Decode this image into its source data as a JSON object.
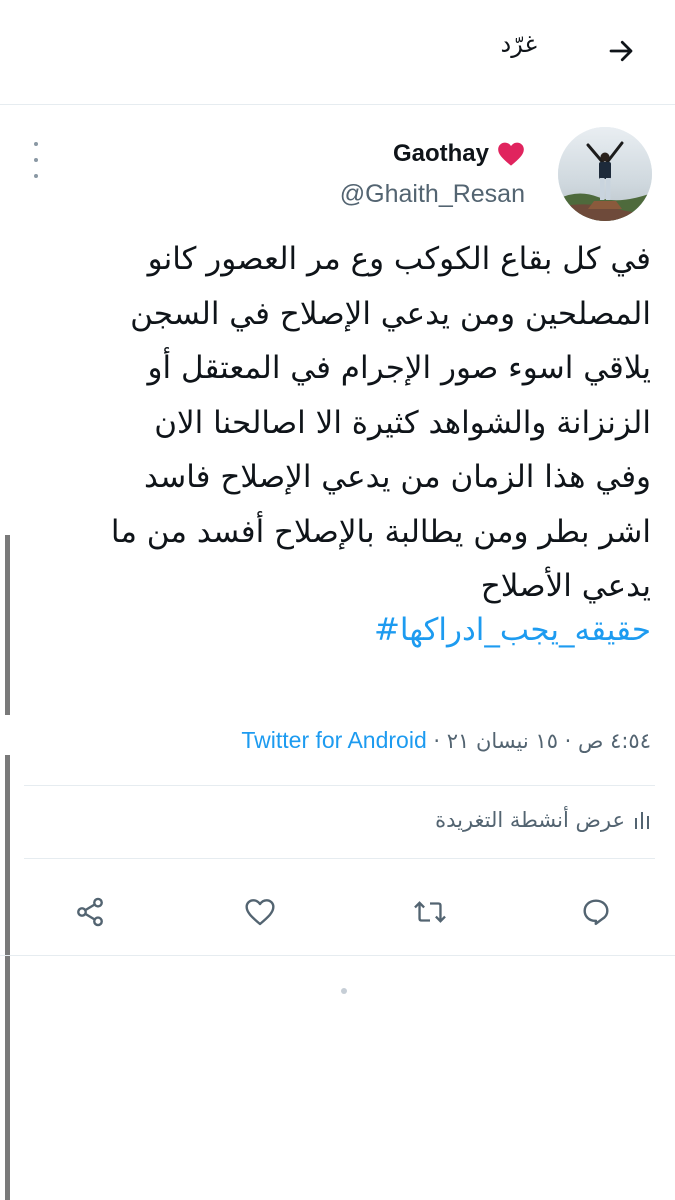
{
  "header": {
    "title": "غرّد"
  },
  "tweet": {
    "display_name": "Gaothay",
    "handle": "@Ghaith_Resan",
    "lines": [
      "في كل بقاع الكوكب وع مر العصور كانو",
      "المصلحين ومن يدعي الإصلاح في السجن",
      "يلاقي اسوء صور الإجرام في المعتقل أو",
      "الزنزانة والشواهد كثيرة الا اصالحنا الان",
      "وفي هذا الزمان من يدعي الإصلاح فاسد",
      "اشر بطر ومن يطالبة بالإصلاح أفسد من ما",
      "يدعي الأصلاح"
    ],
    "hashtag": "حقيقه_يجب_ادراكها#",
    "time_date": "٤:٥٤ ص · ١٥ نيسان ٢١ · ",
    "source": "Twitter for Android",
    "activity_label": "عرض أنشطة التغريدة"
  },
  "icons": {
    "back": "arrow-right-icon",
    "more": "vertical-dots-icon",
    "heart": "red-heart-emoji",
    "activity": "bar-chart-icon",
    "reply": "reply-icon",
    "retweet": "retweet-icon",
    "like": "like-icon",
    "share": "share-icon"
  },
  "colors": {
    "accent": "#1d9bf0",
    "heart": "#e0245e",
    "secondary_text": "#536471"
  }
}
